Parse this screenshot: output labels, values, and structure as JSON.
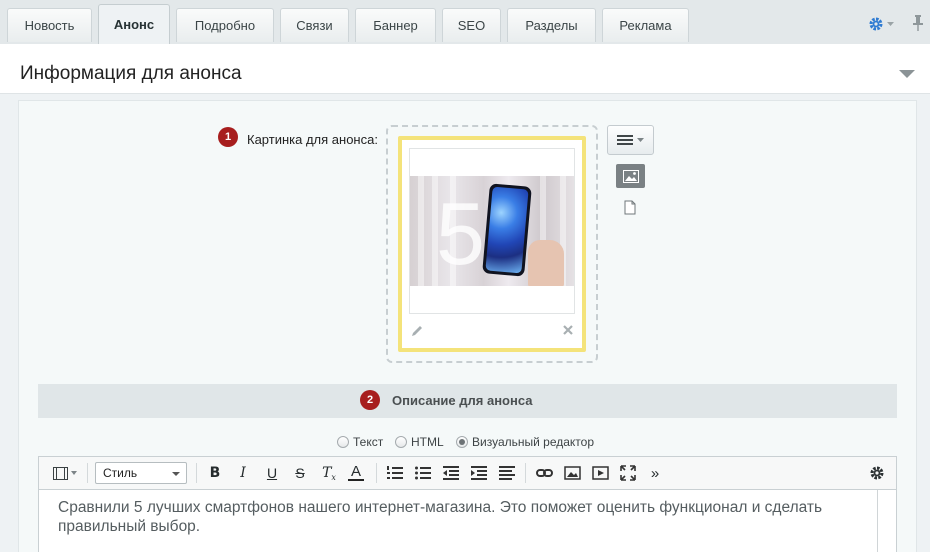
{
  "tabs": [
    {
      "label": "Новость"
    },
    {
      "label": "Анонс",
      "active": true
    },
    {
      "label": "Подробно"
    },
    {
      "label": "Связи"
    },
    {
      "label": "Баннер"
    },
    {
      "label": "SEO"
    },
    {
      "label": "Разделы"
    },
    {
      "label": "Реклама"
    }
  ],
  "tab_icons": [
    "gear-icon",
    "pin-icon"
  ],
  "section": {
    "title": "Информация для анонса"
  },
  "picture": {
    "badge": "1",
    "label": "Картинка для анонса:",
    "image_text": "5",
    "icons": [
      "pencil-icon",
      "close-icon",
      "menu-icon",
      "image-icon",
      "file-icon"
    ]
  },
  "description": {
    "badge": "2",
    "title": "Описание для анонса",
    "modes": [
      "Текст",
      "HTML",
      "Визуальный редактор"
    ],
    "selected_mode": "Визуальный редактор"
  },
  "toolbar": {
    "style_label": "Стиль",
    "items": [
      "bold-icon",
      "italic-icon",
      "underline-icon",
      "strikethrough-icon",
      "clear-format-icon",
      "text-color-icon",
      "ordered-list-icon",
      "bullet-list-icon",
      "outdent-icon",
      "indent-icon",
      "align-icon",
      "link-icon",
      "insert-image-icon",
      "insert-video-icon",
      "fullscreen-icon",
      "more-icon",
      "settings-icon"
    ]
  },
  "editor": {
    "text": "Сравнили 5 лучших смартфонов нашего интернет-магазина. Это поможет оценить функционал и сделать правильный выбор."
  },
  "colors": {
    "badge": "#a71e1e",
    "highlight_border": "#f4e37a",
    "accent_gear": "#2f7bd2"
  }
}
